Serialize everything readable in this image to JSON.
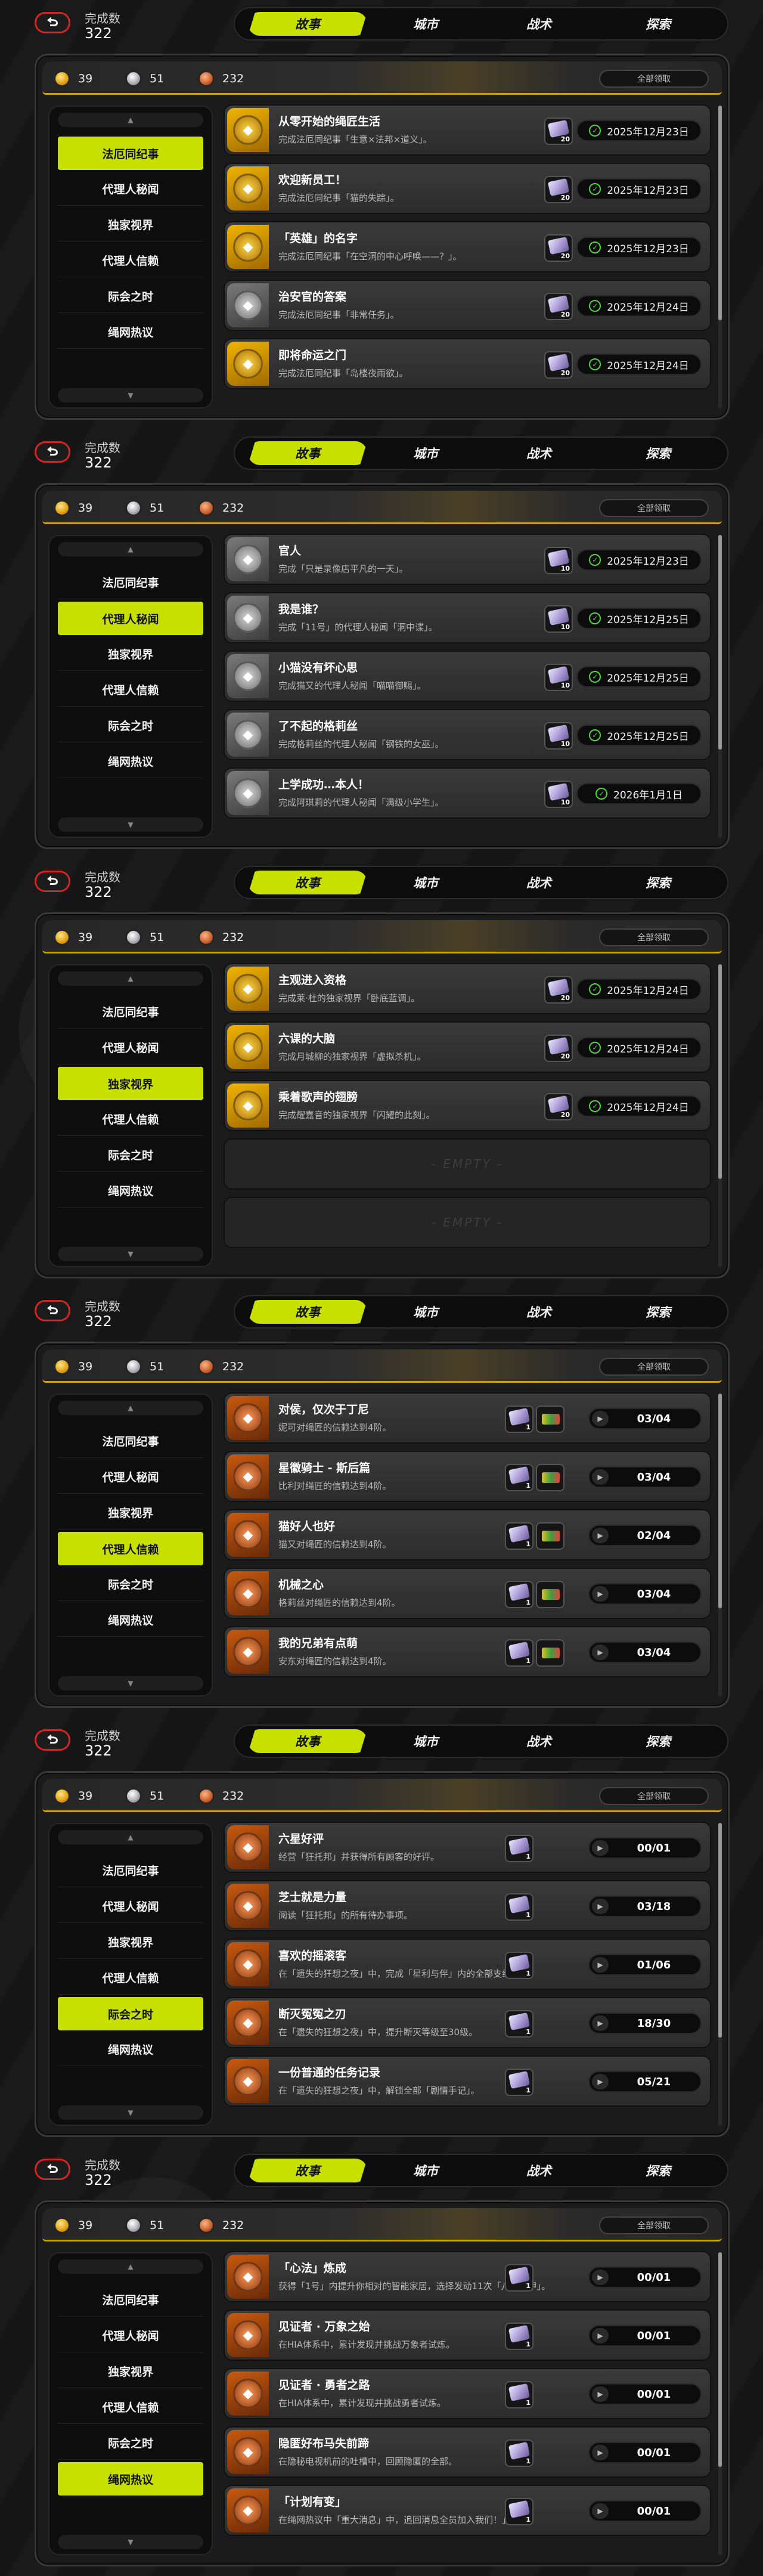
{
  "header": {
    "done_label": "完成数",
    "done_count": "322"
  },
  "tabs": [
    "故事",
    "城市",
    "战术",
    "探索"
  ],
  "currencies": [
    "39",
    "51",
    "232"
  ],
  "claim_all": "全部领取",
  "sidebar": [
    "法厄同纪事",
    "代理人秘闻",
    "独家视界",
    "代理人信赖",
    "际会之时",
    "绳网热议"
  ],
  "empty_label": "- EMPTY -",
  "colors": {
    "accent": "#c8e000",
    "back_ring": "#d42525",
    "done_check": "#5ad04a"
  },
  "screens": [
    {
      "active_sidebar": 0,
      "rows": [
        {
          "title": "从零开始的绳匠生活",
          "desc": "完成法厄同纪事「生意×法邦×道义」。",
          "reward_qty": "20",
          "date": "2025年12月23日",
          "medal": "gold"
        },
        {
          "title": "欢迎新员工！",
          "desc": "完成法厄同纪事「猫的失踪」。",
          "reward_qty": "20",
          "date": "2025年12月23日",
          "medal": "gold"
        },
        {
          "title": "「英雄」的名字",
          "desc": "完成法厄同纪事「在空洞的中心呼唤——？」。",
          "reward_qty": "20",
          "date": "2025年12月23日",
          "medal": "gold"
        },
        {
          "title": "治安官的答案",
          "desc": "完成法厄同纪事「非常任务」。",
          "reward_qty": "20",
          "date": "2025年12月24日",
          "medal": "gray"
        },
        {
          "title": "即将命运之门",
          "desc": "完成法厄同纪事「岛楼夜雨欲」。",
          "reward_qty": "20",
          "date": "2025年12月24日",
          "medal": "gold"
        }
      ]
    },
    {
      "active_sidebar": 1,
      "rows": [
        {
          "title": "官人",
          "desc": "完成「只是录像店平凡的一天」。",
          "reward_qty": "10",
          "date": "2025年12月23日",
          "medal": "gray"
        },
        {
          "title": "我是谁？",
          "desc": "完成「11号」的代理人秘闻「洞中谍」。",
          "reward_qty": "10",
          "date": "2025年12月25日",
          "medal": "gray"
        },
        {
          "title": "小猫没有坏心思",
          "desc": "完成猫又的代理人秘闻「喵喵御赐」。",
          "reward_qty": "10",
          "date": "2025年12月25日",
          "medal": "gray"
        },
        {
          "title": "了不起的格莉丝",
          "desc": "完成格莉丝的代理人秘闻「钢铁的女巫」。",
          "reward_qty": "10",
          "date": "2025年12月25日",
          "medal": "gray"
        },
        {
          "title": "上学成功…本人！",
          "desc": "完成阿琪莉的代理人秘闻「满级小学生」。",
          "reward_qty": "10",
          "date": "2026年1月1日",
          "medal": "gray"
        }
      ]
    },
    {
      "active_sidebar": 2,
      "rows": [
        {
          "title": "主观进入资格",
          "desc": "完成莱·杜的独家视界「卧底蓝调」。",
          "reward_qty": "20",
          "date": "2025年12月24日",
          "medal": "gold"
        },
        {
          "title": "六课的大脑",
          "desc": "完成月城柳的独家视界「虚拟杀机」。",
          "reward_qty": "20",
          "date": "2025年12月24日",
          "medal": "gold"
        },
        {
          "title": "乘着歌声的翅膀",
          "desc": "完成耀嘉音的独家视界「闪耀的此刻」。",
          "reward_qty": "20",
          "date": "2025年12月24日",
          "medal": "gold"
        }
      ]
    },
    {
      "active_sidebar": 3,
      "rows": [
        {
          "title": "对侯，仅次于丁尼",
          "desc": "妮可对绳匠的信赖达到4阶。",
          "reward_qty": "1",
          "progress": "03/04",
          "medal": "orange"
        },
        {
          "title": "星徽骑士 - 斯后篇",
          "desc": "比利对绳匠的信赖达到4阶。",
          "reward_qty": "1",
          "progress": "03/04",
          "medal": "orange"
        },
        {
          "title": "猫好人也好",
          "desc": "猫又对绳匠的信赖达到4阶。",
          "reward_qty": "1",
          "progress": "02/04",
          "medal": "orange"
        },
        {
          "title": "机械之心",
          "desc": "格莉丝对绳匠的信赖达到4阶。",
          "reward_qty": "1",
          "progress": "03/04",
          "medal": "orange"
        },
        {
          "title": "我的兄弟有点萌",
          "desc": "安东对绳匠的信赖达到4阶。",
          "reward_qty": "1",
          "progress": "03/04",
          "medal": "orange"
        }
      ]
    },
    {
      "active_sidebar": 4,
      "rows": [
        {
          "title": "六星好评",
          "desc": "经营「狂托邦」并获得所有顾客的好评。",
          "reward_qty": "1",
          "progress": "00/01",
          "medal": "orange"
        },
        {
          "title": "芝士就是力量",
          "desc": "阅读「狂托邦」的所有待办事项。",
          "reward_qty": "1",
          "progress": "03/18",
          "medal": "orange"
        },
        {
          "title": "喜欢的摇滚客",
          "desc": "在「遗失的狂想之夜」中，完成「星利与伴」内的全部支线剧情。",
          "reward_qty": "1",
          "progress": "01/06",
          "medal": "orange"
        },
        {
          "title": "断灭冤冤之刃",
          "desc": "在「遗失的狂想之夜」中，提升断灭等级至30级。",
          "reward_qty": "1",
          "progress": "18/30",
          "medal": "orange"
        },
        {
          "title": "一份普通的任务记录",
          "desc": "在「遗失的狂想之夜」中，解锁全部「剧情手记」。",
          "reward_qty": "1",
          "progress": "05/21",
          "medal": "orange"
        }
      ]
    },
    {
      "active_sidebar": 5,
      "rows": [
        {
          "title": "「心法」炼成",
          "desc": "获得「1号」内提升你相对的智能家居，选择发动11次「八门遁甲」。",
          "reward_qty": "1",
          "progress": "00/01",
          "medal": "orange"
        },
        {
          "title": "见证者 · 万象之始",
          "desc": "在HIA体系中，累计发现并挑战万象者试炼。",
          "reward_qty": "1",
          "progress": "00/01",
          "medal": "orange"
        },
        {
          "title": "见证者 · 勇者之路",
          "desc": "在HIA体系中，累计发现并挑战勇者试炼。",
          "reward_qty": "1",
          "progress": "00/01",
          "medal": "orange"
        },
        {
          "title": "隐匿好布马失前蹄",
          "desc": "在隐秘电视机前的吐槽中，回顾隐匿的全部。",
          "reward_qty": "1",
          "progress": "00/01",
          "medal": "orange"
        },
        {
          "title": "「计划有变」",
          "desc": "在绳网热议中「重大消息」中，追回消息全员加入我们！」。",
          "reward_qty": "1",
          "progress": "00/01",
          "medal": "orange"
        }
      ]
    }
  ]
}
